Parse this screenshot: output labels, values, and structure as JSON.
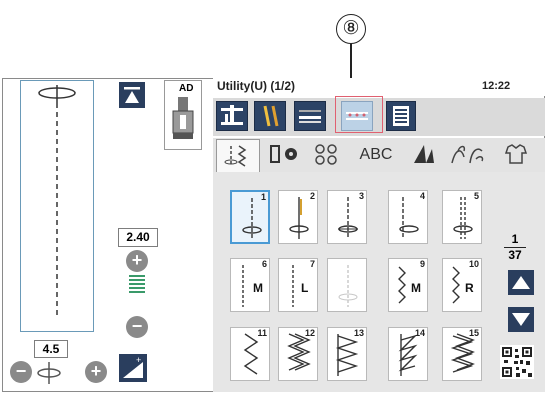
{
  "callout": {
    "label": "⑧"
  },
  "header": {
    "title": "Utility(U) (1/2)",
    "clock": "12:22"
  },
  "left_panel": {
    "presser_foot": "AD",
    "width_value": "2.40",
    "length_value": "4.5",
    "plus": "+",
    "minus": "−"
  },
  "tabs": [
    {
      "label": "",
      "icon": "utility-stitch-icon",
      "active": true
    },
    {
      "label": "",
      "icon": "buttonhole-icon"
    },
    {
      "label": "",
      "icon": "applique-icon"
    },
    {
      "label": "ABC",
      "icon": "lettering-icon"
    },
    {
      "label": "",
      "icon": "quilt-icon"
    },
    {
      "label": "",
      "icon": "decorative-icon"
    },
    {
      "label": "",
      "icon": "heirloom-icon"
    }
  ],
  "stitches": [
    {
      "num": "1",
      "letter": "",
      "pattern": "straight-center",
      "selected": true
    },
    {
      "num": "2",
      "letter": "",
      "pattern": "straight-triple"
    },
    {
      "num": "3",
      "letter": "",
      "pattern": "straight-left"
    },
    {
      "num": "4",
      "letter": "",
      "pattern": "straight-right"
    },
    {
      "num": "5",
      "letter": "",
      "pattern": "triple-heavy"
    },
    {
      "num": "6",
      "letter": "M",
      "pattern": "straight-m"
    },
    {
      "num": "7",
      "letter": "L",
      "pattern": "straight-l"
    },
    {
      "num": "",
      "letter": "",
      "pattern": "disabled"
    },
    {
      "num": "9",
      "letter": "M",
      "pattern": "zigzag-m"
    },
    {
      "num": "10",
      "letter": "R",
      "pattern": "zigzag-r"
    },
    {
      "num": "11",
      "letter": "",
      "pattern": "zigzag"
    },
    {
      "num": "12",
      "letter": "",
      "pattern": "zigzag-double"
    },
    {
      "num": "13",
      "letter": "",
      "pattern": "overcast"
    },
    {
      "num": "14",
      "letter": "",
      "pattern": "overcast-slant"
    },
    {
      "num": "15",
      "letter": "",
      "pattern": "overlock"
    }
  ],
  "pager": {
    "current": "1",
    "total": "37"
  }
}
